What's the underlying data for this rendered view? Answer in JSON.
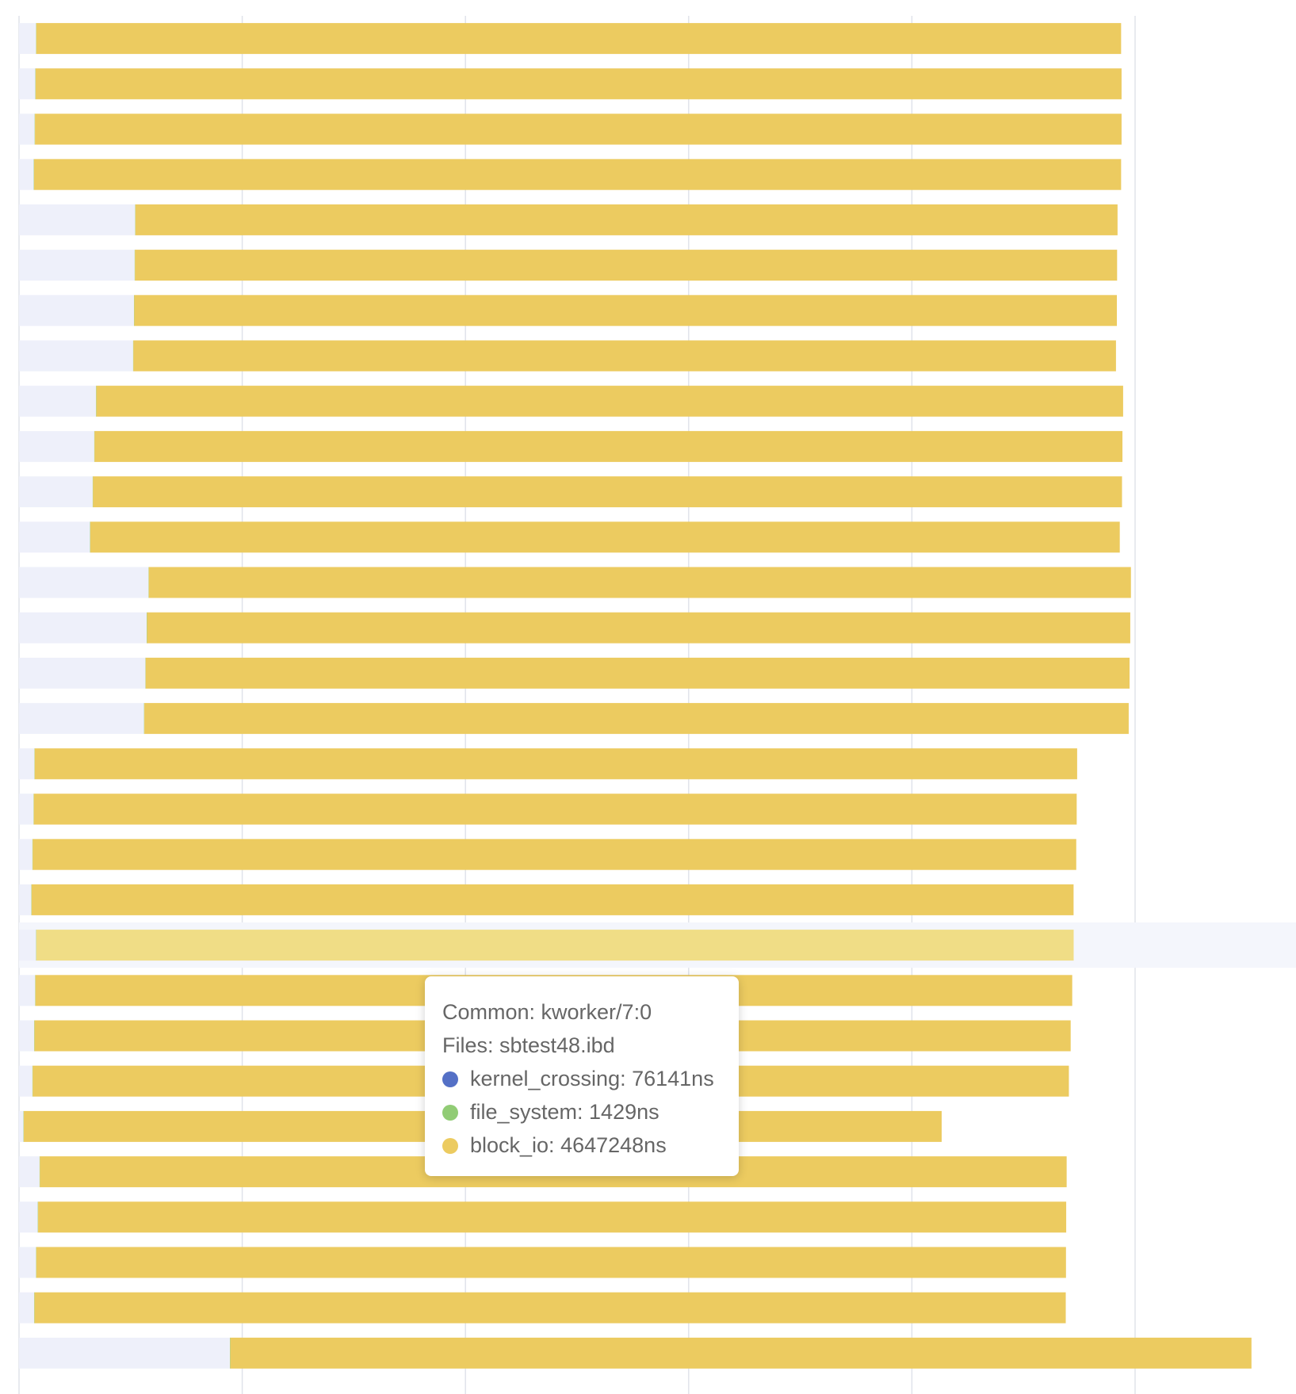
{
  "chart_data": {
    "type": "bar",
    "orientation": "horizontal",
    "stacked": true,
    "grid": true,
    "xlim": [
      0,
      5000000
    ],
    "series": [
      {
        "name": "kernel_crossing",
        "color": "#5470c6",
        "values": [
          76000,
          73000,
          70000,
          66000,
          520000,
          518000,
          515000,
          511000,
          345000,
          337000,
          330000,
          318000,
          580000,
          572000,
          566000,
          560000,
          69000,
          65000,
          60000,
          55000,
          76141,
          72000,
          68000,
          60000,
          20000,
          92000,
          84000,
          76000,
          68000,
          945000
        ]
      },
      {
        "name": "file_system",
        "color": "#91cc75",
        "values": [
          1400,
          1400,
          1400,
          1400,
          1400,
          1400,
          1400,
          1400,
          1400,
          1400,
          1400,
          1400,
          1400,
          1400,
          1400,
          1400,
          1400,
          1400,
          1400,
          1400,
          1429,
          1400,
          1400,
          1400,
          1400,
          1400,
          1400,
          1400,
          1400,
          1400
        ]
      },
      {
        "name": "block_io",
        "color": "#eccb60",
        "values": [
          4860000,
          4865000,
          4868000,
          4870000,
          4400000,
          4400000,
          4402000,
          4402000,
          4600000,
          4605000,
          4610000,
          4612000,
          4400000,
          4405000,
          4408000,
          4410000,
          4670000,
          4672000,
          4675000,
          4668000,
          4647248,
          4645000,
          4642000,
          4642000,
          4112000,
          4600000,
          4606000,
          4613000,
          4620000,
          4575000
        ]
      }
    ],
    "highlight_index": 20,
    "emphasis_color": "#f0dd86",
    "shadow_color": "#eef0fa",
    "grid_color": "#e0e3ea"
  },
  "tooltip": {
    "common": "Common: kworker/7:0",
    "files": "Files: sbtest48.ibd",
    "items": [
      {
        "label": "kernel_crossing: 76141ns",
        "color": "#5470c6"
      },
      {
        "label": "file_system: 1429ns",
        "color": "#91cc75"
      },
      {
        "label": "block_io: 4647248ns",
        "color": "#eccb60"
      }
    ]
  }
}
